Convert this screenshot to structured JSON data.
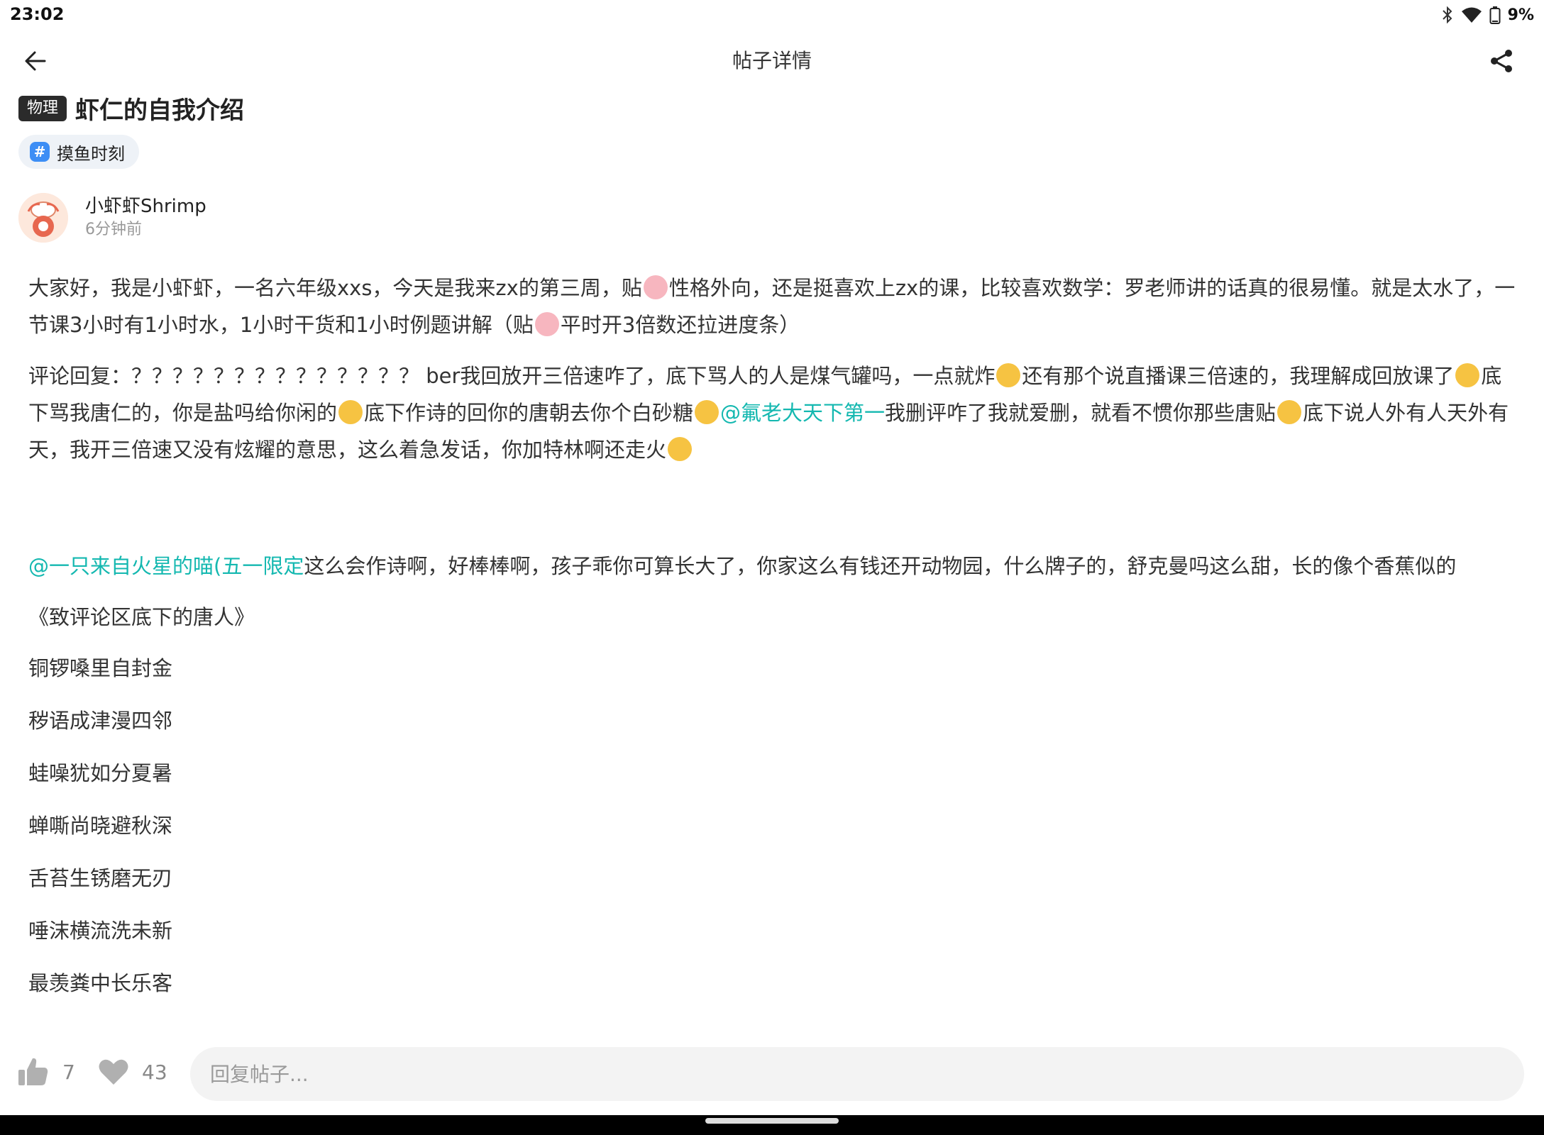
{
  "status_bar": {
    "time": "23:02",
    "battery": "9%",
    "icons": [
      "bluetooth-icon",
      "wifi-icon",
      "battery-icon"
    ]
  },
  "app_bar": {
    "title": "帖子详情",
    "back_icon": "arrow-left-icon",
    "share_icon": "share-icon"
  },
  "post": {
    "subject_tag": "物理",
    "title": "虾仁的自我介绍",
    "topic": {
      "hash": "#",
      "label": "摸鱼时刻"
    },
    "author": {
      "name": "小虾虾Shrimp",
      "time": "6分钟前"
    },
    "para1": {
      "t1": "大家好，我是小虾虾，一名六年级xxs，今天是我来zx的第三周，贴",
      "t2": "性格外向，还是挺喜欢上zx的课，比较喜欢数学：罗老师讲的话真的很易懂。就是太水了，一节课3小时有1小时水，1小时干货和1小时例题讲解（贴",
      "t3": "平时开3倍数还拉进度条）"
    },
    "para2": {
      "t1": "评论回复：？？？？？？？？？？？？？？ ber我回放开三倍速咋了，底下骂人的人是煤气罐吗，一点就炸",
      "t2": "还有那个说直播课三倍速的，我理解成回放课了",
      "t3": "底下骂我唐仁的，你是盐吗给你闲的",
      "t4": "底下作诗的回你的唐朝去你个白砂糖",
      "mention": "@氟老大天下第一",
      "t5": "我删评咋了我就爱删，就看不惯你那些唐贴",
      "t6": "底下说人外有人天外有天，我开三倍速又没有炫耀的意思，这么着急发话，你加特林啊还走火"
    },
    "para3": {
      "mention": "@一只来自火星的喵(五一限定",
      "t1": "这么会作诗啊，好棒棒啊，孩子乖你可算长大了，你家这么有钱还开动物园，什么牌子的，舒克曼吗这么甜，长的像个香蕉似的"
    },
    "poem_title": "《致评论区底下的唐人》",
    "poem": [
      "铜锣嗓里自封金",
      "秽语成津漫四邻",
      "蛙噪犹如分夏暑",
      "蝉嘶尚晓避秋深",
      "舌苔生锈磨无刃",
      "唾沫横流洗未新",
      "最羡粪中长乐客"
    ]
  },
  "bottom_bar": {
    "like_count": "7",
    "fav_count": "43",
    "reply_placeholder": "回复帖子..."
  },
  "colors": {
    "mention": "#14b8b0",
    "tag_bg": "#2b2b2b",
    "topic_icon": "#3d8ef5"
  }
}
